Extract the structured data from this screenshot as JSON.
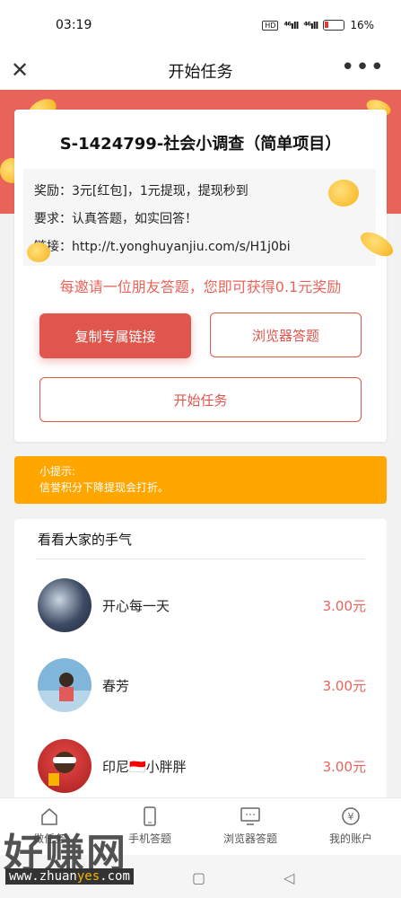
{
  "status_bar": {
    "time": "03:19",
    "hd": "HD",
    "signal_1": "⁴⁶ıll",
    "signal_2": "⁴⁶ıll",
    "battery": "16%"
  },
  "title_bar": {
    "title": "开始任务",
    "close_icon": "close-icon",
    "more_icon": "more-icon"
  },
  "task": {
    "title": "S-1424799-社会小调查（简单项目）",
    "reward": "奖励：3元[红包]，1元提现，提现秒到",
    "requirement": "要求：认真答题，如实回答！",
    "link": "链接：http://t.yonghuyanjiu.com/s/H1j0bi",
    "invite_text": "每邀请一位朋友答题，您即可获得0.1元奖励"
  },
  "buttons": {
    "copy": "复制专属链接",
    "browser": "浏览器答题",
    "start": "开始任务"
  },
  "tip": {
    "line1": "小提示:",
    "line2": "信誉积分下降提现会打折。"
  },
  "list": {
    "title": "看看大家的手气",
    "items": [
      {
        "name": "开心每一天",
        "amount": "3.00元"
      },
      {
        "name": "春芳",
        "amount": "3.00元"
      },
      {
        "name": "印尼🇮🇩小胖胖",
        "amount": "3.00元"
      }
    ]
  },
  "tabbar": {
    "items": [
      {
        "label": "做任务",
        "icon": "home-icon"
      },
      {
        "label": "手机答题",
        "icon": "phone-icon"
      },
      {
        "label": "浏览器答题",
        "icon": "monitor-icon"
      },
      {
        "label": "我的账户",
        "icon": "yuan-icon"
      }
    ]
  },
  "watermark": {
    "brand": "好赚网",
    "url_pre": "www.zhuan",
    "url_hl": "yes",
    "url_post": ".com"
  },
  "colors": {
    "accent": "#e0564c",
    "tip": "#ffa600",
    "banner": "#e8645a"
  }
}
